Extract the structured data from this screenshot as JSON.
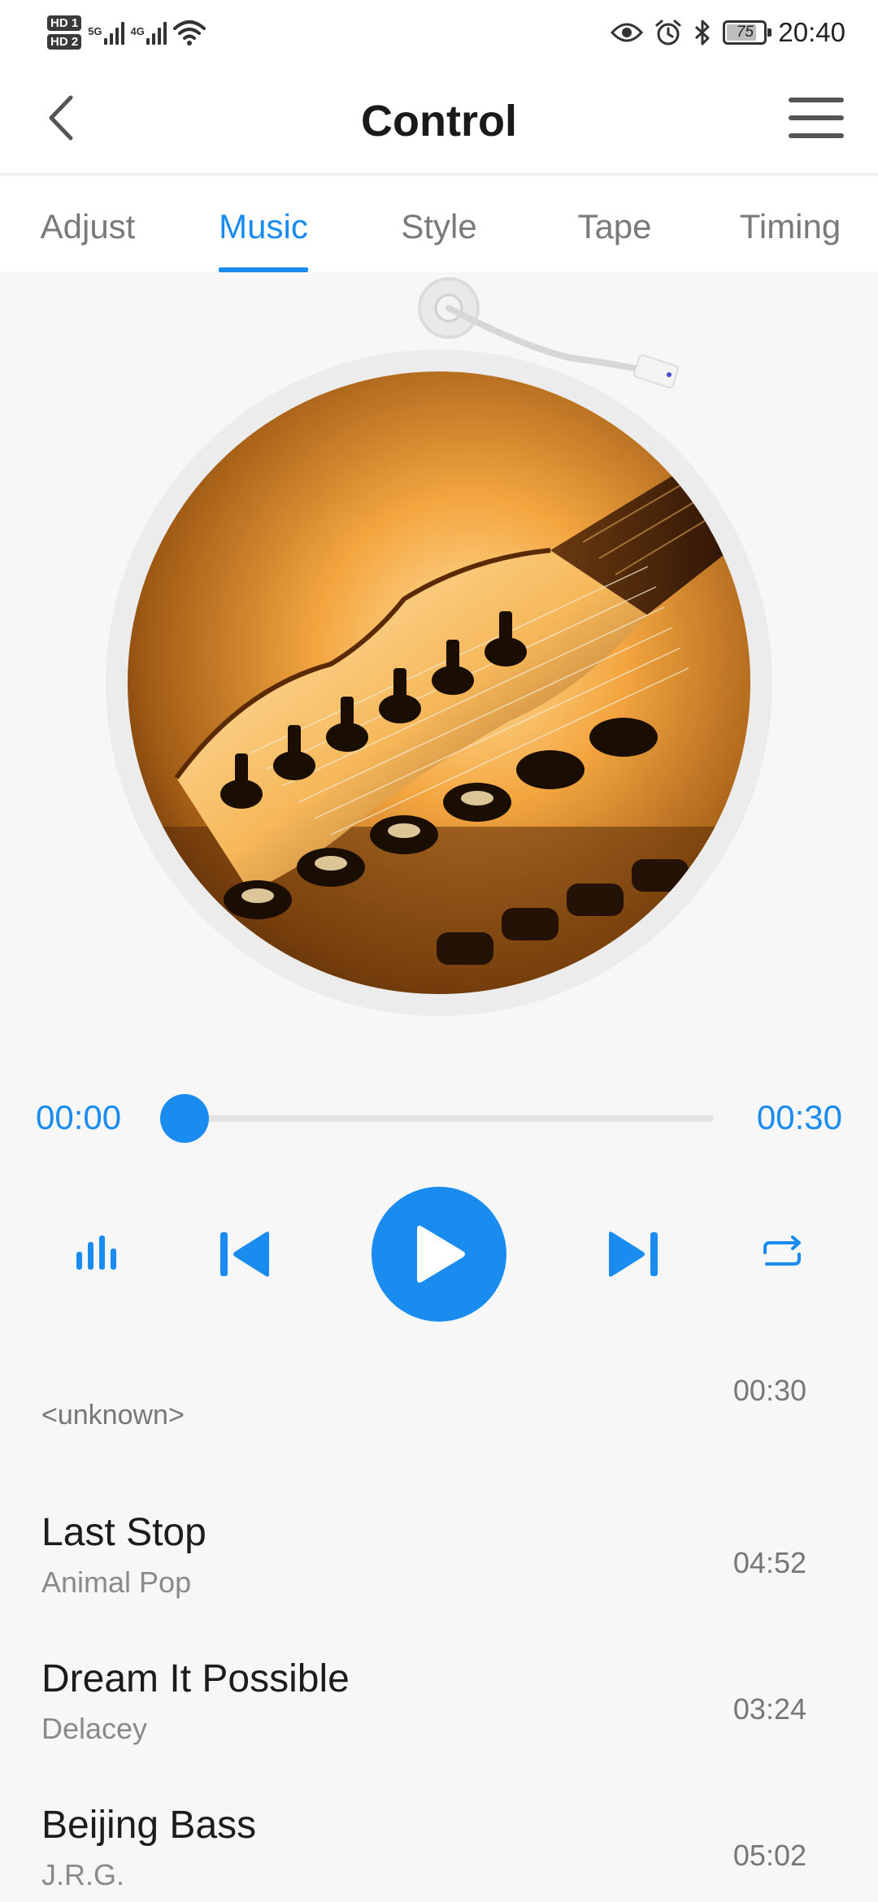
{
  "status_bar": {
    "sim1_badge": "HD 1",
    "sim2_badge": "HD 2",
    "sim1_network": "5G",
    "sim2_network": "4G",
    "battery_level": "75",
    "time": "20:40",
    "icons": [
      "signal-icon",
      "wifi-icon",
      "eye-icon",
      "alarm-icon",
      "bluetooth-icon",
      "battery-icon"
    ]
  },
  "header": {
    "title": "Control",
    "back_icon": "chevron-left-icon",
    "menu_icon": "hamburger-menu-icon"
  },
  "tabs": [
    {
      "label": "Adjust",
      "active": false
    },
    {
      "label": "Music",
      "active": true
    },
    {
      "label": "Style",
      "active": false
    },
    {
      "label": "Tape",
      "active": false
    },
    {
      "label": "Timing",
      "active": false
    }
  ],
  "player": {
    "current_time": "00:00",
    "total_time": "00:30",
    "progress": 0.0,
    "accent_color": "#1a8cf0",
    "cover_art": "guitar-headstock-image"
  },
  "controls": [
    {
      "name": "equalizer-icon"
    },
    {
      "name": "previous-track-icon"
    },
    {
      "name": "play-icon"
    },
    {
      "name": "next-track-icon"
    },
    {
      "name": "repeat-icon"
    }
  ],
  "playlist": [
    {
      "title": "<unknown>",
      "artist": "",
      "duration": "00:30"
    },
    {
      "title": "Last Stop",
      "artist": "Animal Pop",
      "duration": "04:52"
    },
    {
      "title": "Dream It Possible",
      "artist": "Delacey",
      "duration": "03:24"
    },
    {
      "title": "Beijing Bass",
      "artist": "J.R.G.",
      "duration": "05:02"
    }
  ]
}
